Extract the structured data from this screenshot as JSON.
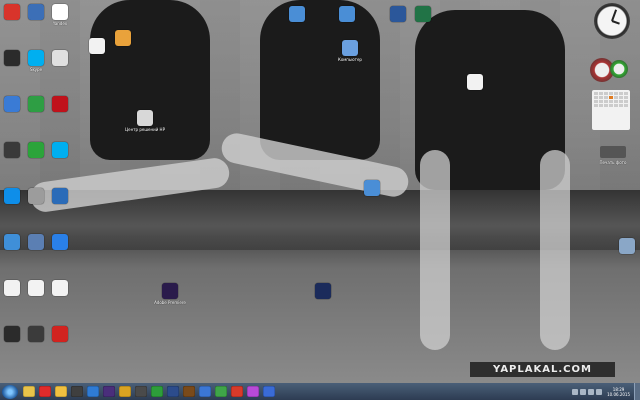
{
  "desktop": {
    "icons_left": [
      {
        "name": "pdf-icon",
        "label": "",
        "color": "#d9342b"
      },
      {
        "name": "app-icon",
        "label": "",
        "color": "#3c6fb7"
      },
      {
        "name": "yandex-browser-icon",
        "label": "Yandex",
        "color": "#ffffff"
      },
      {
        "name": "app-icon",
        "label": "",
        "color": "#2b2b2b"
      },
      {
        "name": "skype-icon",
        "label": "Skype",
        "color": "#00aff0"
      },
      {
        "name": "app-icon",
        "label": "",
        "color": "#e0e0e0"
      },
      {
        "name": "settings-icon",
        "label": "",
        "color": "#3a7bd5"
      },
      {
        "name": "settings-icon",
        "label": "",
        "color": "#2e9e44"
      },
      {
        "name": "pdf-icon",
        "label": "",
        "color": "#c0121b"
      },
      {
        "name": "app-icon",
        "label": "",
        "color": "#3a3a3a"
      },
      {
        "name": "app-icon",
        "label": "",
        "color": "#2ba43a"
      },
      {
        "name": "skype-icon",
        "label": "",
        "color": "#00aff0"
      },
      {
        "name": "teamviewer-icon",
        "label": "",
        "color": "#0e8ee9"
      },
      {
        "name": "app-icon",
        "label": "",
        "color": "#9c9c9c"
      },
      {
        "name": "app-icon",
        "label": "",
        "color": "#2a6bb8"
      },
      {
        "name": "app-icon",
        "label": "",
        "color": "#3f8fd8"
      },
      {
        "name": "app-icon",
        "label": "",
        "color": "#5b7fb3"
      },
      {
        "name": "dropbox-icon",
        "label": "",
        "color": "#2a80e8"
      },
      {
        "name": "document-icon",
        "label": "",
        "color": "#f2f2f2"
      },
      {
        "name": "document-icon",
        "label": "",
        "color": "#f2f2f2"
      },
      {
        "name": "document-icon",
        "label": "",
        "color": "#f2f2f2"
      },
      {
        "name": "app-icon",
        "label": "",
        "color": "#2b2b2b"
      },
      {
        "name": "app-icon",
        "label": "",
        "color": "#3b3b3b"
      },
      {
        "name": "avira-icon",
        "label": "",
        "color": "#d2231f"
      }
    ],
    "icons_scattered": [
      {
        "name": "app-icon",
        "label": "",
        "color": "#e9a23b"
      },
      {
        "name": "document-icon",
        "label": "",
        "color": "#f2f2f2"
      },
      {
        "name": "app-icon",
        "label": "Центр решений HP",
        "color": "#d8d8d8"
      },
      {
        "name": "app-icon",
        "label": "",
        "color": "#4a8ed6"
      },
      {
        "name": "app-icon",
        "label": "",
        "color": "#4a8ed6"
      },
      {
        "name": "computer-icon",
        "label": "Компьютер",
        "color": "#6aa0e0"
      },
      {
        "name": "word-icon",
        "label": "",
        "color": "#2b579a"
      },
      {
        "name": "excel-icon",
        "label": "",
        "color": "#217346"
      },
      {
        "name": "document-icon",
        "label": "",
        "color": "#f2f2f2"
      },
      {
        "name": "network-icon",
        "label": "",
        "color": "#4a8ed6"
      },
      {
        "name": "premiere-icon",
        "label": "Adobe Premiere",
        "color": "#2a1b4b"
      },
      {
        "name": "encore-icon",
        "label": "",
        "color": "#1b2b5b"
      },
      {
        "name": "recycle-bin-icon",
        "label": "",
        "color": "#8aa7c7"
      }
    ],
    "watermark": "YAPLAKAL.COM"
  },
  "gadgets": {
    "calendar_label": "",
    "printer_label": "Печать фото"
  },
  "taskbar": {
    "items": [
      {
        "name": "explorer-taskbar-icon",
        "color": "#e8c34a"
      },
      {
        "name": "yandex-taskbar-icon",
        "color": "#e12b2b"
      },
      {
        "name": "folder-taskbar-icon",
        "color": "#f0c040"
      },
      {
        "name": "app-taskbar-icon",
        "color": "#3f3f3f"
      },
      {
        "name": "photoshop-taskbar-icon",
        "color": "#2f7bd5"
      },
      {
        "name": "premiere-taskbar-icon",
        "color": "#4a2e7b"
      },
      {
        "name": "app-taskbar-icon",
        "color": "#d9a322"
      },
      {
        "name": "app-taskbar-icon",
        "color": "#4a4a4a"
      },
      {
        "name": "app-taskbar-icon",
        "color": "#2d9e3a"
      },
      {
        "name": "app-taskbar-icon",
        "color": "#2c4c8c"
      },
      {
        "name": "bridge-taskbar-icon",
        "color": "#7a4a1a"
      },
      {
        "name": "app-taskbar-icon",
        "color": "#3b77d6"
      },
      {
        "name": "chrome-taskbar-icon",
        "color": "#3fa548"
      },
      {
        "name": "app-taskbar-icon",
        "color": "#d83a2a"
      },
      {
        "name": "app-taskbar-icon",
        "color": "#b84ad8"
      },
      {
        "name": "app-taskbar-icon",
        "color": "#3a6bd6"
      }
    ],
    "clock_time": "18:29",
    "clock_date": "10.06.2015"
  }
}
